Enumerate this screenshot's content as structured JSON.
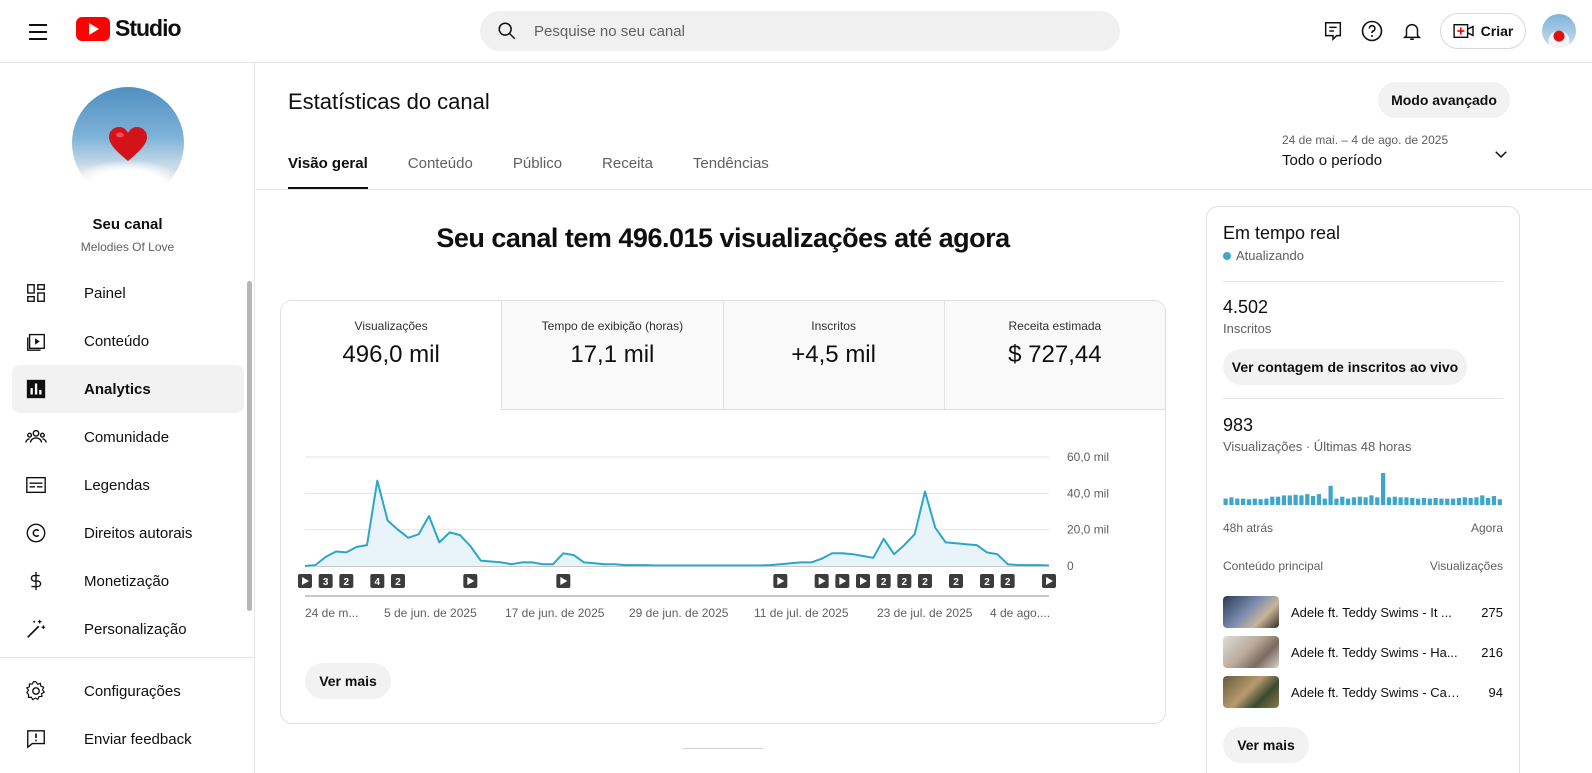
{
  "header": {
    "logo_text": "Studio",
    "search_placeholder": "Pesquise no seu canal",
    "create_label": "Criar"
  },
  "sidebar": {
    "channel_name": "Seu canal",
    "channel_subtitle": "Melodies Of Love",
    "items": [
      {
        "label": "Painel",
        "icon": "dashboard-icon",
        "active": false
      },
      {
        "label": "Conteúdo",
        "icon": "content-icon",
        "active": false
      },
      {
        "label": "Analytics",
        "icon": "analytics-icon",
        "active": true
      },
      {
        "label": "Comunidade",
        "icon": "community-icon",
        "active": false
      },
      {
        "label": "Legendas",
        "icon": "subtitles-icon",
        "active": false
      },
      {
        "label": "Direitos autorais",
        "icon": "copyright-icon",
        "active": false
      },
      {
        "label": "Monetização",
        "icon": "monetization-icon",
        "active": false
      },
      {
        "label": "Personalização",
        "icon": "customization-icon",
        "active": false
      }
    ],
    "bottom_items": [
      {
        "label": "Configurações",
        "icon": "settings-icon"
      },
      {
        "label": "Enviar feedback",
        "icon": "feedback-icon"
      }
    ]
  },
  "main": {
    "title": "Estatísticas do canal",
    "advanced_button": "Modo avançado",
    "tabs": [
      {
        "label": "Visão geral",
        "active": true
      },
      {
        "label": "Conteúdo",
        "active": false
      },
      {
        "label": "Público",
        "active": false
      },
      {
        "label": "Receita",
        "active": false
      },
      {
        "label": "Tendências",
        "active": false
      }
    ],
    "period": {
      "range": "24 de mai. – 4 de ago. de 2025",
      "label": "Todo o período"
    },
    "headline": "Seu canal tem 496.015 visualizações até agora",
    "metrics": [
      {
        "label": "Visualizações",
        "value": "496,0 mil",
        "active": true
      },
      {
        "label": "Tempo de exibição (horas)",
        "value": "17,1 mil",
        "active": false
      },
      {
        "label": "Inscritos",
        "value": "+4,5 mil",
        "active": false
      },
      {
        "label": "Receita estimada",
        "value": "$ 727,44",
        "active": false
      }
    ],
    "see_more": "Ver mais"
  },
  "chart_data": {
    "type": "area",
    "series": [
      {
        "values": [
          0,
          0.5,
          5,
          8,
          7.5,
          10.5,
          11.5,
          47,
          25,
          20,
          15.5,
          17.5,
          27.5,
          13,
          18.5,
          17,
          11,
          3,
          2.5,
          2,
          1,
          2,
          2,
          1,
          1,
          7,
          6,
          2,
          1.5,
          1,
          1,
          0.5,
          0.5,
          0.5,
          0.3,
          0.3,
          0.3,
          0.3,
          0.3,
          0.3,
          0.3,
          0.3,
          0.3,
          0.3,
          0.3,
          0.5,
          1,
          1.5,
          2,
          2,
          4,
          7,
          7,
          6.5,
          5.5,
          4.5,
          15,
          6.5,
          11.5,
          17.5,
          41,
          21,
          13,
          12.5,
          12,
          11.5,
          7.5,
          6.5,
          1,
          0.5,
          0.5,
          0.5,
          0.3
        ]
      }
    ],
    "x_tick_labels": [
      "24 de m...",
      "5 de jun. de 2025",
      "17 de jun. de 2025",
      "29 de jun. de 2025",
      "11 de jul. de 2025",
      "23 de jul. de 2025",
      "4 de ago...."
    ],
    "y_tick_labels": [
      "0",
      "20,0 mil",
      "40,0 mil",
      "60,0 mil"
    ],
    "ylim": [
      0,
      60
    ],
    "y_unit": "mil",
    "color": "#2ba6c9",
    "fill_color": "#e8f4fa",
    "grid": true,
    "markers": [
      {
        "day": 0,
        "type": "play"
      },
      {
        "day": 2,
        "type": "num",
        "text": "3"
      },
      {
        "day": 4,
        "type": "num",
        "text": "2"
      },
      {
        "day": 7,
        "type": "num",
        "text": "4"
      },
      {
        "day": 9,
        "type": "num",
        "text": "2"
      },
      {
        "day": 16,
        "type": "play"
      },
      {
        "day": 25,
        "type": "play"
      },
      {
        "day": 46,
        "type": "play"
      },
      {
        "day": 50,
        "type": "play"
      },
      {
        "day": 52,
        "type": "play"
      },
      {
        "day": 54,
        "type": "play"
      },
      {
        "day": 56,
        "type": "num",
        "text": "2"
      },
      {
        "day": 58,
        "type": "num",
        "text": "2"
      },
      {
        "day": 60,
        "type": "num",
        "text": "2"
      },
      {
        "day": 63,
        "type": "num",
        "text": "2"
      },
      {
        "day": 66,
        "type": "num",
        "text": "2"
      },
      {
        "day": 68,
        "type": "num",
        "text": "2"
      },
      {
        "day": 72,
        "type": "play"
      }
    ]
  },
  "realtime": {
    "title": "Em tempo real",
    "status": "Atualizando",
    "subscribers_value": "4.502",
    "subscribers_label": "Inscritos",
    "live_button": "Ver contagem de inscritos ao vivo",
    "views_value": "983",
    "views_label": "Visualizações · Últimas 48 horas",
    "axis_start": "48h atrás",
    "axis_end": "Agora",
    "top_content_label": "Conteúdo principal",
    "top_views_label": "Visualizações",
    "hourly_views": [
      10,
      12,
      10,
      10,
      9,
      10,
      9,
      10,
      13,
      13,
      15,
      15,
      16,
      15,
      17,
      14,
      17,
      10,
      30,
      10,
      13,
      10,
      12,
      13,
      12,
      15,
      12,
      50,
      12,
      13,
      12,
      12,
      11,
      10,
      11,
      10,
      11,
      10,
      10,
      10,
      11,
      12,
      11,
      12,
      15,
      11,
      14,
      9
    ],
    "top_videos": [
      {
        "title": "Adele ft. Teddy Swims - It ...",
        "views": "275"
      },
      {
        "title": "Adele ft. Teddy Swims - Ha...",
        "views": "216"
      },
      {
        "title": "Adele ft. Teddy Swims - Can’...",
        "views": "94"
      }
    ],
    "see_more": "Ver mais"
  }
}
